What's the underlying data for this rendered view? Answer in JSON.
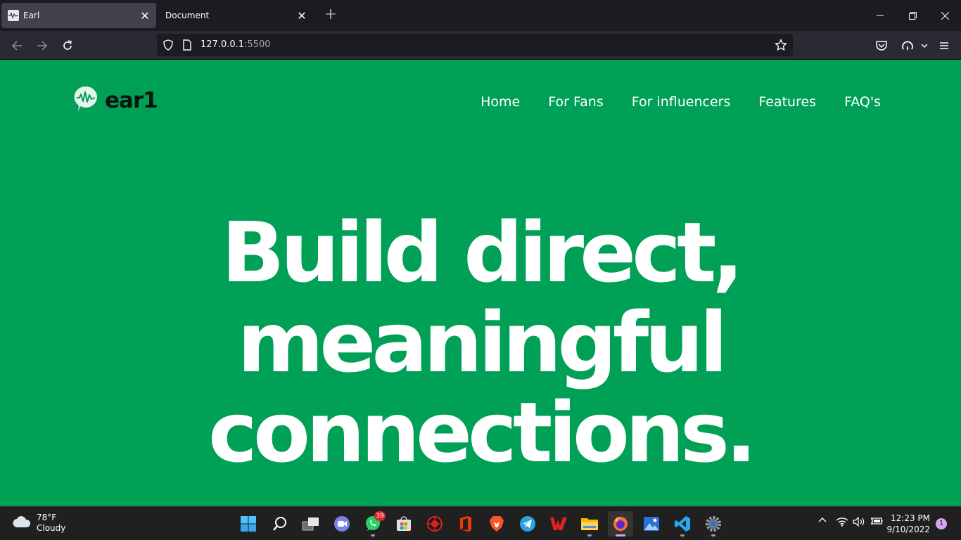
{
  "browser": {
    "tabs": [
      {
        "title": "Earl",
        "active": true
      },
      {
        "title": "Document",
        "active": false
      }
    ],
    "url_host": "127.0.0.1",
    "url_port": ":5500"
  },
  "site": {
    "logo_text": "ear1",
    "nav": [
      "Home",
      "For Fans",
      "For influencers",
      "Features",
      "FAQ's"
    ],
    "hero_lines": [
      "Build direct,",
      "meaningful",
      "connections."
    ],
    "colors": {
      "background": "#00a056",
      "logo_dark": "#0a1510",
      "text": "#ffffff"
    }
  },
  "taskbar": {
    "weather_temp": "78°F",
    "weather_desc": "Cloudy",
    "whatsapp_badge": "39",
    "time": "12:23 PM",
    "date": "9/10/2022",
    "notification_count": "1",
    "apps": [
      "start-icon",
      "search-icon",
      "task-view-icon",
      "teams-icon",
      "whatsapp-icon",
      "store-icon",
      "antivirus-icon",
      "office-icon",
      "brave-icon",
      "telegram-icon",
      "wps-icon",
      "file-explorer-icon",
      "firefox-icon",
      "photos-icon",
      "vscode-icon",
      "settings-icon"
    ]
  }
}
